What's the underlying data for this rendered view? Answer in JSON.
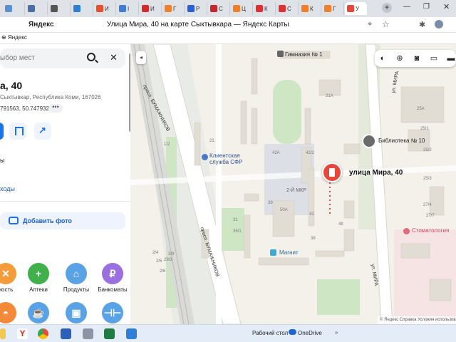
{
  "browser": {
    "tabs": [
      {
        "label": "",
        "color": "#5a8fd6"
      },
      {
        "label": "",
        "color": "#4a6fa5"
      },
      {
        "label": "",
        "color": "#555"
      },
      {
        "label": "",
        "color": "#2f7fd7"
      },
      {
        "label": "И",
        "color": "#e84f2b"
      },
      {
        "label": "I",
        "color": "#3b7dd8"
      },
      {
        "label": "И",
        "color": "#d32a2a"
      },
      {
        "label": "Г",
        "color": "#f07f2a"
      },
      {
        "label": "Р",
        "color": "#2a5fd6"
      },
      {
        "label": "С",
        "color": "#c9252c"
      },
      {
        "label": "Ц",
        "color": "#f07f2a"
      },
      {
        "label": "К",
        "color": "#e02f2f"
      },
      {
        "label": "С",
        "color": "#e02f2f"
      },
      {
        "label": "К",
        "color": "#f07f2a"
      },
      {
        "label": "Г",
        "color": "#f07f2a"
      },
      {
        "label": "У",
        "color": "#e8463c"
      }
    ],
    "new_tab": "+",
    "minimize": "—",
    "maximize": "❐",
    "close": "✕",
    "site_name": "Яндекс",
    "page_title": "Улица Мира, 40 на карте Сыктывкара — Яндекс Карты",
    "bookmark": "Яндекс"
  },
  "panel": {
    "search_placeholder": "ыбор мест",
    "address_title": "а, 40",
    "address_subtitle": "Сыктывкар, Республика Коми, 167026",
    "coordinates": "791563, 50.747932",
    "coord_more": "•••",
    "fragment_1": "ы",
    "fragment_2": "ходы",
    "add_photo": "Добавить фото",
    "categories": [
      {
        "label": "ность",
        "icon": "fork-knife-icon",
        "color": "#f49b3a",
        "glyph": "✕"
      },
      {
        "label": "Аптеки",
        "icon": "pharmacy-cross-icon",
        "color": "#3fb04a",
        "glyph": "+"
      },
      {
        "label": "Продукты",
        "icon": "basket-icon",
        "color": "#5aa2e6",
        "glyph": "⌂"
      },
      {
        "label": "Банкоматы",
        "icon": "ruble-icon",
        "color": "#9b6fe0",
        "glyph": "₽"
      },
      {
        "label": "",
        "icon": "hat-icon",
        "color": "#f28a3a",
        "glyph": "◓"
      },
      {
        "label": "",
        "icon": "cup-icon",
        "color": "#5aa2e6",
        "glyph": "☕"
      },
      {
        "label": "",
        "icon": "bag-icon",
        "color": "#5aa2e6",
        "glyph": "▣"
      },
      {
        "label": "",
        "icon": "dumbbell-icon",
        "color": "#5aa2e6",
        "glyph": "⊣⊢"
      }
    ]
  },
  "map": {
    "collapse": "◂",
    "tools": [
      "layers-icon",
      "binoculars-icon",
      "camera-icon",
      "bus-icon",
      "car-icon"
    ],
    "pin_label": "улица Мира, 40",
    "labels": {
      "gymnasium": "Гимназия № 1",
      "library": "Библиотека № 10",
      "sfr": "Клиентская\nслужба СФР",
      "district": "2-Й МКР",
      "magnit": "Магнит",
      "dentistry": "Стоматология",
      "street_bumazhnikov_1": "просп. БУМАЖНИКОВ",
      "street_bumazhnikov_2": "просп. БУМАЖНИКОВ",
      "street_mira_1": "ул. МИРА",
      "street_mira_2": "ул. МИРА"
    },
    "house_numbers": [
      "21А",
      "25А",
      "25/1",
      "25/2",
      "25/3",
      "21",
      "42А",
      "42/2",
      "42",
      "48",
      "50А",
      "38",
      "29/3",
      "31",
      "35/1",
      "39",
      "27/4",
      "27/7",
      "2/4",
      "2/5",
      "2/6",
      "3/9",
      "1/2"
    ],
    "copyright": "© Яндекс  Справка  Условия использования"
  },
  "taskbar": {
    "desktop": "Рабочий стол",
    "onedrive": "OneDrive",
    "arrow": "»"
  }
}
